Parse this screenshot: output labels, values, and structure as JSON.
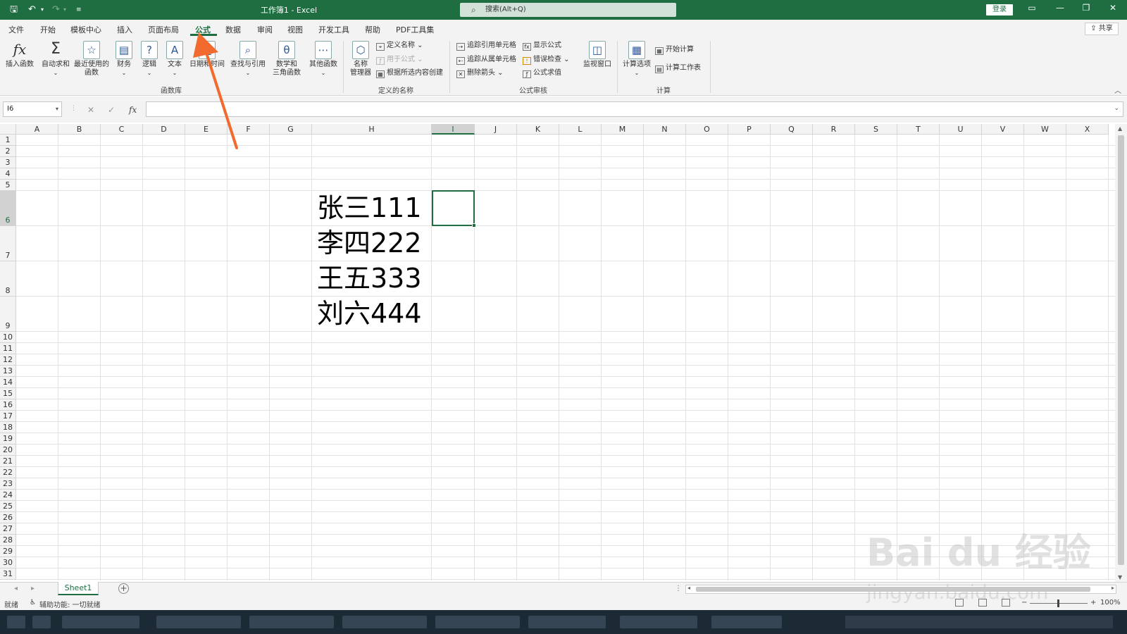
{
  "window": {
    "title": "工作簿1  -  Excel",
    "search_placeholder": "搜索(Alt+Q)",
    "login_label": "登录"
  },
  "ribbon_tabs": [
    "文件",
    "开始",
    "模板中心",
    "插入",
    "页面布局",
    "公式",
    "数据",
    "审阅",
    "视图",
    "开发工具",
    "帮助",
    "PDF工具集"
  ],
  "active_tab": "公式",
  "share_label": "共享",
  "ribbon": {
    "function_library": {
      "buttons": [
        {
          "label": "插入函数",
          "icon": "fx-icon"
        },
        {
          "label": "自动求和",
          "icon": "sigma-icon"
        },
        {
          "label": "最近使用的",
          "label2": "函数",
          "icon": "star-icon"
        },
        {
          "label": "财务",
          "icon": "finance-icon"
        },
        {
          "label": "逻辑",
          "icon": "logic-icon"
        },
        {
          "label": "文本",
          "icon": "text-icon"
        },
        {
          "label": "日期和时间",
          "icon": "calendar-icon"
        },
        {
          "label": "查找与引用",
          "icon": "lookup-icon"
        },
        {
          "label": "数学和",
          "label2": "三角函数",
          "icon": "math-icon"
        },
        {
          "label": "其他函数",
          "icon": "more-functions-icon"
        }
      ],
      "group_label": "函数库"
    },
    "defined_names": {
      "name_manager": "名称",
      "name_manager2": "管理器",
      "define_name": "定义名称",
      "use_in_formula": "用于公式",
      "create_from_selection": "根据所选内容创建",
      "group_label": "定义的名称"
    },
    "formula_auditing": {
      "trace_precedents": "追踪引用单元格",
      "trace_dependents": "追踪从属单元格",
      "remove_arrows": "删除箭头",
      "show_formulas": "显示公式",
      "error_checking": "错误检查",
      "evaluate_formula": "公式求值",
      "watch_window": "监视窗口",
      "group_label": "公式审核"
    },
    "calculation": {
      "calc_options": "计算选项",
      "calc_now": "开始计算",
      "calc_sheet": "计算工作表",
      "group_label": "计算"
    }
  },
  "formula_bar": {
    "name_box": "I6",
    "cancel": "✕",
    "enter": "✓",
    "fx": "fx",
    "content": ""
  },
  "columns": [
    "A",
    "B",
    "C",
    "D",
    "E",
    "F",
    "G",
    "H",
    "I",
    "J",
    "K",
    "L",
    "M",
    "N",
    "O",
    "P",
    "Q",
    "R",
    "S",
    "T",
    "U",
    "V",
    "W",
    "X"
  ],
  "selected_column": "I",
  "rows": [
    "1",
    "2",
    "3",
    "4",
    "5",
    "6",
    "7",
    "8",
    "9",
    "10",
    "11",
    "12",
    "13",
    "14",
    "15",
    "16",
    "17",
    "18",
    "19",
    "20",
    "21",
    "22",
    "23",
    "24",
    "25",
    "26",
    "27",
    "28",
    "29",
    "30",
    "31"
  ],
  "selected_row": "6",
  "cells": {
    "H6": "张三111",
    "H7": "李四222",
    "H8": "王五333",
    "H9": "刘六444"
  },
  "sheets": [
    "Sheet1"
  ],
  "status": {
    "ready": "就绪",
    "accessibility": "辅助功能: 一切就绪",
    "zoom": "100%"
  },
  "watermark": {
    "logo": "Bai du 经验",
    "url": "jingyan.baidu.com"
  }
}
